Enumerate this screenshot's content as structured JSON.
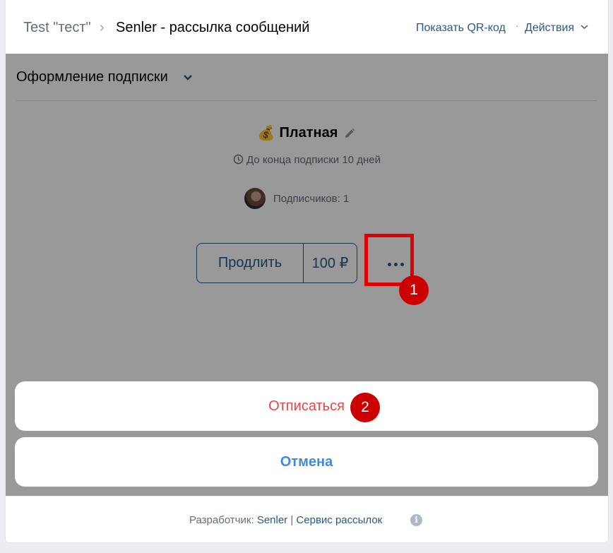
{
  "header": {
    "breadcrumb_group": "Test \"тест\"",
    "breadcrumb_separator": "›",
    "breadcrumb_app": "Senler - рассылка сообщений",
    "qr_link": "Показать QR-код",
    "dot_separator": "·",
    "actions_link": "Действия"
  },
  "section": {
    "title": "Оформление подписки"
  },
  "plan": {
    "emoji": "💰",
    "name": "Платная",
    "until": "До конца подписки 10 дней",
    "subscribers": "Подписчиков: 1"
  },
  "buttons": {
    "extend": "Продлить",
    "price": "100 ₽"
  },
  "action_sheet": {
    "unsubscribe": "Отписаться",
    "cancel": "Отмена"
  },
  "annotations": {
    "marker_1": "1",
    "marker_2": "2"
  },
  "footer": {
    "developer_label": "Разработчик:",
    "developer_link": "Senler",
    "separator": "|",
    "service_link": "Сервис рассылок",
    "info_glyph": "i"
  },
  "colors": {
    "link": "#2a5885",
    "danger": "#e64646",
    "accent": "#3f8ae0",
    "annotation": "#cc0000"
  }
}
